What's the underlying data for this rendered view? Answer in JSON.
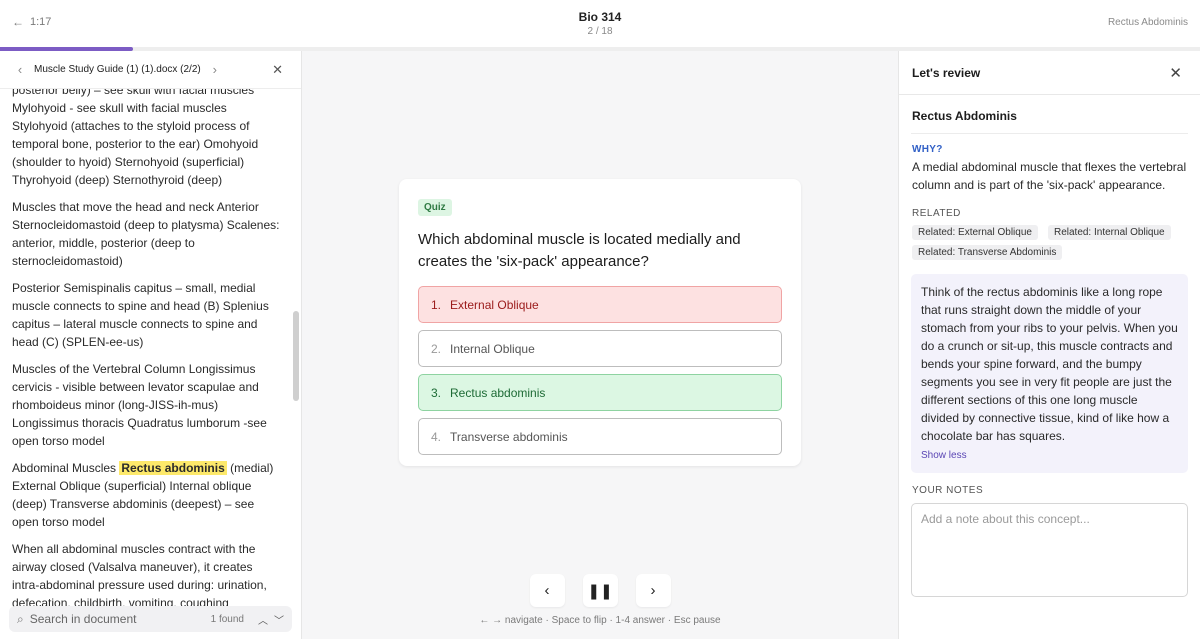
{
  "header": {
    "back_time": "1:17",
    "title": "Bio 314",
    "counter": "2 / 18",
    "concept": "Rectus Abdominis",
    "progress": 0.111
  },
  "document": {
    "name": "Muscle Study Guide (1) (1).docx (2/2)",
    "paragraphs": [
      "posterior belly) – see skull with facial muscles Mylohyoid - see skull with facial muscles Stylohyoid (attaches to the styloid process of temporal bone, posterior to the ear) Omohyoid (shoulder to hyoid) Sternohyoid (superficial) Thyrohyoid (deep) Sternothyroid (deep)",
      "Muscles that move the head and neck Anterior Sternocleidomastoid (deep to platysma) Scalenes: anterior, middle, posterior (deep to sternocleidomastoid)",
      "Posterior Semispinalis capitus – small, medial muscle connects to spine and head (B) Splenius capitus – lateral muscle connects to spine and head (C) (SPLEN-ee-us)",
      "Muscles of the Vertebral Column Longissimus cervicis - visible between levator scapulae and rhomboideus minor (long-JISS-ih-mus) Longissimus thoracis Quadratus lumborum -see open torso model"
    ],
    "hl_before": "Abdominal Muscles ",
    "hl_text": "Rectus abdominis",
    "hl_after": " (medial) External Oblique (superficial) Internal oblique (deep) Transverse abdominis (deepest) – see open torso model",
    "last_paragraph": "When all abdominal muscles contract with the airway closed (Valsalva maneuver), it creates intra-abdominal pressure used during: urination, defecation, childbirth, vomiting, coughing",
    "search_placeholder": "Search in document",
    "found": "1 found"
  },
  "quiz": {
    "badge": "Quiz",
    "question": "Which abdominal muscle is located medially and creates the 'six-pack' appearance?",
    "options": [
      {
        "num": "1.",
        "label": "External Oblique"
      },
      {
        "num": "2.",
        "label": "Internal Oblique"
      },
      {
        "num": "3.",
        "label": "Rectus abdominis"
      },
      {
        "num": "4.",
        "label": "Transverse abdominis"
      }
    ],
    "hint": "← → navigate · Space to flip · 1-4 answer · Esc pause"
  },
  "review": {
    "heading": "Let's review",
    "concept": "Rectus Abdominis",
    "why_label": "WHY?",
    "why_text": "A medial abdominal muscle that flexes the vertebral column and is part of the 'six-pack' appearance.",
    "related_label": "RELATED",
    "related": [
      "Related: External Oblique",
      "Related: Internal Oblique",
      "Related: Transverse Abdominis"
    ],
    "explanation": "Think of the rectus abdominis like a long rope that runs straight down the middle of your stomach from your ribs to your pelvis. When you do a crunch or sit-up, this muscle contracts and bends your spine forward, and the bumpy segments you see in very fit people are just the different sections of this one long muscle divided by connective tissue, kind of like how a chocolate bar has squares.",
    "show_less": "Show less",
    "notes_label": "YOUR NOTES",
    "notes_placeholder": "Add a note about this concept..."
  },
  "colors": {
    "accent": "#7c5cc4",
    "wrong": "#fde1e1",
    "correct": "#dcf7e3",
    "highlight": "#fde96b"
  },
  "icons": [
    "arrow-left-icon",
    "chevron-left-icon",
    "chevron-right-icon",
    "close-icon",
    "search-icon",
    "chevron-up-icon",
    "chevron-down-icon",
    "pause-icon"
  ]
}
